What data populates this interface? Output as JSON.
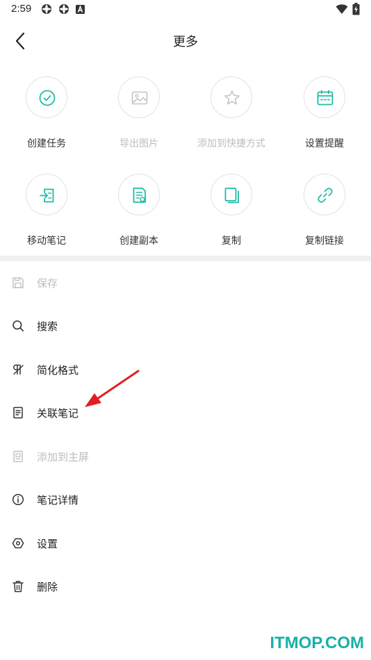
{
  "status_bar": {
    "time": "2:59"
  },
  "header": {
    "title": "更多"
  },
  "colors": {
    "accent": "#1fbba6",
    "disabled": "#bdbdbd",
    "text": "#222222",
    "annotation": "#e02020",
    "watermark": "#17b1a8"
  },
  "actions": [
    {
      "label": "创建任务",
      "icon": "check-circle-icon",
      "enabled": true
    },
    {
      "label": "导出图片",
      "icon": "image-icon",
      "enabled": false
    },
    {
      "label": "添加到快捷方式",
      "icon": "star-icon",
      "enabled": false
    },
    {
      "label": "设置提醒",
      "icon": "calendar-icon",
      "enabled": true
    },
    {
      "label": "移动笔记",
      "icon": "move-note-icon",
      "enabled": true
    },
    {
      "label": "创建副本",
      "icon": "duplicate-note-icon",
      "enabled": true
    },
    {
      "label": "复制",
      "icon": "copy-icon",
      "enabled": true
    },
    {
      "label": "复制链接",
      "icon": "link-icon",
      "enabled": true
    }
  ],
  "menu": [
    {
      "label": "保存",
      "icon": "save-icon",
      "enabled": false
    },
    {
      "label": "搜索",
      "icon": "search-icon",
      "enabled": true
    },
    {
      "label": "简化格式",
      "icon": "clear-format-icon",
      "enabled": true
    },
    {
      "label": "关联笔记",
      "icon": "linked-note-icon",
      "enabled": true
    },
    {
      "label": "添加到主屏",
      "icon": "home-screen-icon",
      "enabled": false
    },
    {
      "label": "笔记详情",
      "icon": "info-icon",
      "enabled": true
    },
    {
      "label": "设置",
      "icon": "settings-icon",
      "enabled": true
    },
    {
      "label": "删除",
      "icon": "trash-icon",
      "enabled": true
    }
  ],
  "watermark": "ITMOP.COM"
}
